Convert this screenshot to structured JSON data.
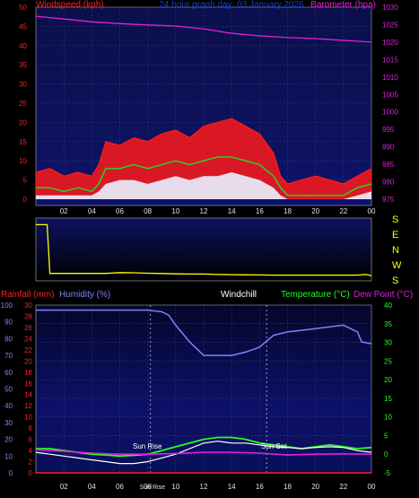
{
  "title": "24 hour graph day: 03 January 2026",
  "colors": {
    "background": "#000000",
    "plot_top": "#0d1260",
    "plot_bottom": "#000000",
    "wind_speed": "#ff1a1a",
    "wind_gust_fill": "#ff1a1a",
    "wind_avg": "#22dd22",
    "wind_min": "#e8f2ff",
    "barometer": "#e21fe2",
    "wind_dir": "#ffff00",
    "rainfall": "#ff2020",
    "humidity": "#8080ff",
    "windchill": "#ffffff",
    "temperature": "#22ff22",
    "dew_point": "#e21fe2",
    "annotation": "#ffffff"
  },
  "chart_data": [
    {
      "type": "line",
      "name": "wind-and-barometer",
      "left_label": "Windspeed (kph)",
      "right_label": "Barometer (hpa)",
      "title": "24 hour graph day: 03 January 2026",
      "x_ticks": [
        "02",
        "04",
        "06",
        "08",
        "10",
        "12",
        "14",
        "16",
        "18",
        "20",
        "22",
        "00"
      ],
      "left_ticks": [
        "0",
        "5",
        "10",
        "15",
        "20",
        "25",
        "30",
        "35",
        "40",
        "45",
        "50"
      ],
      "right_ticks": [
        "975",
        "980",
        "985",
        "990",
        "995",
        "1000",
        "1005",
        "1010",
        "1015",
        "1020",
        "1025",
        "1030"
      ],
      "ylim_left": [
        0,
        50
      ],
      "ylim_right": [
        975,
        1030
      ],
      "series": [
        {
          "name": "Windspeed gust",
          "axis": "left",
          "x": [
            0,
            1,
            2,
            3,
            4,
            4.5,
            5,
            6,
            7,
            8,
            9,
            10,
            11,
            12,
            13,
            14,
            15,
            16,
            17,
            17.5,
            18,
            19,
            20,
            21,
            22,
            23,
            24
          ],
          "values": [
            7,
            8,
            6,
            7,
            6,
            9,
            15,
            14,
            16,
            15,
            17,
            18,
            16,
            19,
            20,
            21,
            19,
            17,
            12,
            6,
            4,
            5,
            6,
            5,
            4,
            6,
            8
          ]
        },
        {
          "name": "Windspeed average",
          "axis": "left",
          "x": [
            0,
            1,
            2,
            3,
            4,
            4.5,
            5,
            6,
            7,
            8,
            9,
            10,
            11,
            12,
            13,
            14,
            15,
            16,
            17,
            17.5,
            18,
            19,
            20,
            21,
            22,
            23,
            24
          ],
          "values": [
            3,
            3,
            2,
            3,
            2,
            4,
            8,
            8,
            9,
            8,
            9,
            10,
            9,
            10,
            11,
            11,
            10,
            9,
            6,
            3,
            1,
            1,
            1,
            1,
            1,
            3,
            4
          ]
        },
        {
          "name": "Windspeed minimum",
          "axis": "left",
          "x": [
            0,
            1,
            2,
            3,
            4,
            4.5,
            5,
            6,
            7,
            8,
            9,
            10,
            11,
            12,
            13,
            14,
            15,
            16,
            17,
            17.5,
            18,
            19,
            20,
            21,
            22,
            23,
            24
          ],
          "values": [
            1,
            1,
            1,
            1,
            1,
            2,
            4,
            5,
            5,
            4,
            5,
            6,
            5,
            6,
            6,
            7,
            6,
            5,
            3,
            1,
            0,
            0,
            0,
            0,
            0,
            1,
            2
          ]
        },
        {
          "name": "Barometer",
          "axis": "right",
          "x": [
            0,
            2,
            4,
            6,
            8,
            10,
            12,
            14,
            16,
            18,
            20,
            22,
            24
          ],
          "values": [
            1027.4,
            1026.6,
            1025.8,
            1025.3,
            1024.9,
            1024.6,
            1023.8,
            1022.5,
            1021.8,
            1021.3,
            1021.0,
            1020.5,
            1020.0
          ]
        }
      ]
    },
    {
      "type": "line",
      "name": "wind-direction",
      "right_labels": [
        "S",
        "E",
        "N",
        "W",
        "S"
      ],
      "ylim": [
        0,
        360
      ],
      "series": [
        {
          "name": "Wind direction",
          "x": [
            0,
            0.8,
            1.0,
            2,
            3,
            4,
            5,
            6,
            7,
            8,
            9,
            10,
            11,
            12,
            13,
            14,
            15,
            16,
            17,
            18,
            19,
            20,
            21,
            22,
            23,
            23.6,
            24
          ],
          "values": [
            335,
            335,
            30,
            30,
            30,
            30,
            30,
            35,
            34,
            31,
            29,
            27,
            26,
            26,
            23,
            22,
            21,
            20,
            19,
            19,
            19,
            19,
            19,
            19,
            19,
            23,
            16
          ]
        }
      ]
    },
    {
      "type": "line",
      "name": "temperature-humidity",
      "left_labels": [
        "Rainfall (mm)",
        "Humidity (%)"
      ],
      "center_label": "Windchill",
      "right_labels": [
        "Temperature (°C)",
        "Dew Point (°C)"
      ],
      "x_ticks": [
        "02",
        "04",
        "06",
        "Sun Rise",
        "08",
        "10",
        "12",
        "14",
        "16",
        "18",
        "20",
        "22",
        "00"
      ],
      "humidity_ticks": [
        "0",
        "10",
        "20",
        "30",
        "40",
        "50",
        "60",
        "70",
        "80",
        "90",
        "100"
      ],
      "rain_ticks": [
        "0",
        "2",
        "4",
        "6",
        "8",
        "10",
        "12",
        "14",
        "16",
        "18",
        "20",
        "22",
        "24",
        "26",
        "28",
        "30"
      ],
      "temp_ticks": [
        "-5",
        "0",
        "5",
        "10",
        "15",
        "20",
        "25",
        "30",
        "35",
        "40"
      ],
      "ylim_humidity": [
        0,
        100
      ],
      "ylim_temp": [
        -5,
        40
      ],
      "ylim_rain": [
        0,
        30
      ],
      "annotations": [
        {
          "text": "Sun Rise",
          "x": 8.2
        },
        {
          "text": "Sun Set",
          "x": 16.5
        }
      ],
      "series": [
        {
          "name": "Humidity",
          "axis": "humidity",
          "x": [
            0,
            2,
            4,
            6,
            7,
            8,
            9,
            9.5,
            10,
            11,
            12,
            13,
            14,
            15,
            16,
            17,
            18,
            19,
            20,
            21,
            22,
            23,
            23.3,
            24
          ],
          "values": [
            97,
            97,
            97,
            97,
            97,
            97,
            96,
            94,
            88,
            78,
            70,
            70,
            70,
            72,
            75,
            82,
            84,
            85,
            86,
            87,
            88,
            84,
            78,
            77
          ]
        },
        {
          "name": "Temperature",
          "axis": "temp",
          "x": [
            0,
            1,
            2,
            3,
            4,
            5,
            6,
            7,
            8,
            9,
            10,
            11,
            12,
            13,
            14,
            15,
            16,
            17,
            18,
            19,
            20,
            21,
            22,
            23,
            24
          ],
          "values": [
            1.5,
            1.5,
            1.0,
            0.5,
            0.0,
            -0.2,
            -0.5,
            -0.3,
            0.0,
            1.0,
            2.0,
            3.0,
            4.0,
            4.5,
            4.5,
            4.0,
            3.0,
            2.5,
            2.0,
            1.5,
            2.0,
            2.5,
            2.0,
            1.5,
            1.8
          ]
        },
        {
          "name": "Windchill",
          "axis": "temp",
          "x": [
            0,
            1,
            2,
            3,
            4,
            5,
            6,
            7,
            8,
            9,
            10,
            11,
            12,
            13,
            14,
            15,
            16,
            17,
            18,
            19,
            20,
            21,
            22,
            23,
            24
          ],
          "values": [
            0.5,
            0.0,
            -0.5,
            -1.0,
            -1.5,
            -2.0,
            -2.5,
            -2.5,
            -2.0,
            -1.0,
            0.0,
            1.5,
            3.0,
            3.5,
            3.0,
            3.0,
            2.5,
            2.0,
            1.8,
            1.5,
            1.8,
            2.0,
            1.8,
            1.0,
            0.5
          ]
        },
        {
          "name": "Dew Point",
          "axis": "temp",
          "x": [
            0,
            2,
            4,
            6,
            8,
            10,
            12,
            14,
            16,
            18,
            20,
            22,
            24
          ],
          "values": [
            1.2,
            0.8,
            0.3,
            0.0,
            0.0,
            0.2,
            0.5,
            0.5,
            0.3,
            -0.2,
            0.0,
            0.1,
            0.0
          ]
        },
        {
          "name": "Rainfall",
          "axis": "rain",
          "x": [
            0,
            24
          ],
          "values": [
            0,
            0
          ]
        }
      ]
    }
  ]
}
